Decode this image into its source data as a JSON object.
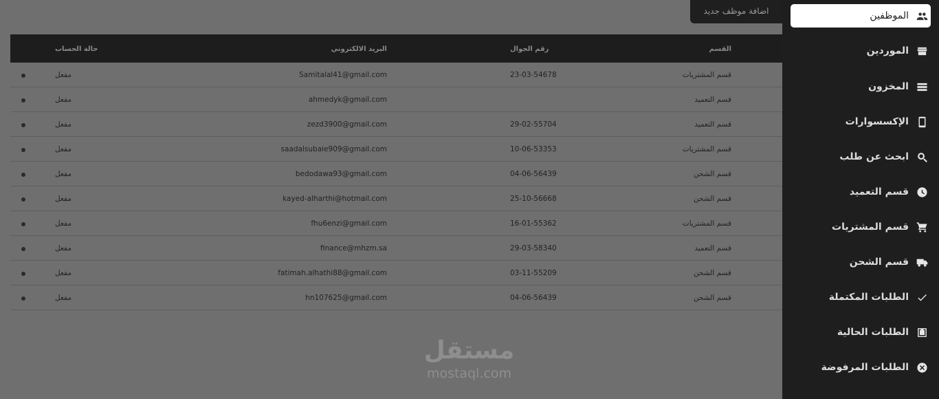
{
  "add_button": "اضافة موظف جديد",
  "table": {
    "headers": {
      "dept": "القسم",
      "phone": "رقم الجوال",
      "email": "البريد الالكتروني",
      "status": "حالة الحساب"
    },
    "rows": [
      {
        "dept": "قسم المشتريات",
        "phone": "23-03-54678",
        "email": "Samitalal41@gmail.com",
        "status": "مفعل"
      },
      {
        "dept": "قسم التعميد",
        "phone": "",
        "email": "ahmedyk@gmail.com",
        "status": "مفعل"
      },
      {
        "dept": "قسم التعميد",
        "phone": "29-02-55704",
        "email": "zezd3900@gmail.com",
        "status": "مفعل"
      },
      {
        "dept": "قسم المشتريات",
        "phone": "10-06-53353",
        "email": "saadalsubaie909@gmail.com",
        "status": "مفعل"
      },
      {
        "dept": "قسم الشحن",
        "phone": "04-06-56439",
        "email": "bedodawa93@gmail.com",
        "status": "مفعل"
      },
      {
        "dept": "قسم الشحن",
        "phone": "25-10-56668",
        "email": "kayed-alharthi@hotmail.com",
        "status": "مفعل"
      },
      {
        "dept": "قسم المشتريات",
        "phone": "16-01-55362",
        "email": "fhu6enzi@gmail.com",
        "status": "مفعل"
      },
      {
        "dept": "قسم التعميد",
        "phone": "29-03-58340",
        "email": "finance@mhzm.sa",
        "status": "مفعل"
      },
      {
        "dept": "قسم الشحن",
        "phone": "03-11-55209",
        "email": "fatimah.alhathi88@gmail.com",
        "status": "مفعل"
      },
      {
        "dept": "قسم الشحن",
        "phone": "04-06-56439",
        "email": "hn107625@gmail.com",
        "status": "مفعل"
      }
    ]
  },
  "sidebar": {
    "items": [
      {
        "label": "الموظفين",
        "icon": "people-icon",
        "active": true
      },
      {
        "label": "الموردين",
        "icon": "store-icon",
        "active": false
      },
      {
        "label": "المخزون",
        "icon": "storage-icon",
        "active": false
      },
      {
        "label": "الإكسسوارات",
        "icon": "phone-icon",
        "active": false
      },
      {
        "label": "ابحث عن طلب",
        "icon": "search-icon",
        "active": false
      },
      {
        "label": "قسم التعميد",
        "icon": "clock-icon",
        "active": false
      },
      {
        "label": "قسم المشتريات",
        "icon": "cart-icon",
        "active": false
      },
      {
        "label": "قسم الشحن",
        "icon": "truck-icon",
        "active": false
      },
      {
        "label": "الطلبات المكتملة",
        "icon": "check-icon",
        "active": false
      },
      {
        "label": "الطلبات الحالية",
        "icon": "inbox-download-icon",
        "active": false
      },
      {
        "label": "الطلبات المرفوضة",
        "icon": "cancel-circle-icon",
        "active": false
      }
    ]
  },
  "watermark": {
    "arabic": "مستقل",
    "latin": "mostaql.com"
  }
}
